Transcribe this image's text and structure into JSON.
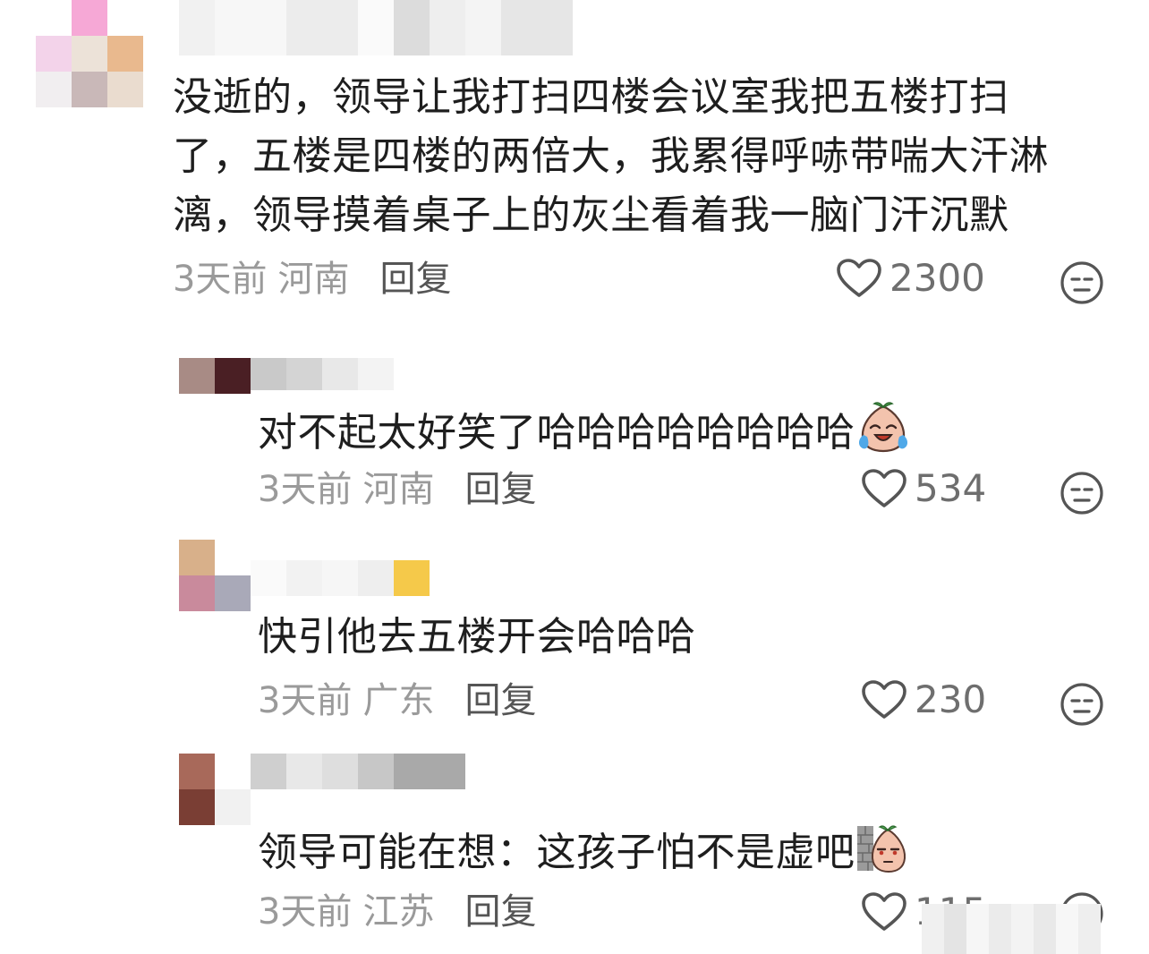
{
  "comments": [
    {
      "text": "没逝的，领导让我打扫四楼会议室我把五楼打扫了，五楼是四楼的两倍大，我累得呼哧带喘大汗淋漓，领导摸着桌子上的灰尘看着我一脑门汗沉默",
      "time": "3天前",
      "location": "河南",
      "reply_label": "回复",
      "likes": "2300"
    },
    {
      "text": "对不起太好笑了哈哈哈哈哈哈哈哈",
      "emoji": "crying-laughing-peach-emoji",
      "time": "3天前",
      "location": "河南",
      "reply_label": "回复",
      "likes": "534"
    },
    {
      "text": "快引他去五楼开会哈哈哈",
      "time": "3天前",
      "location": "广东",
      "reply_label": "回复",
      "likes": "230"
    },
    {
      "text": "领导可能在想：这孩子怕不是虚吧",
      "emoji": "peeking-peach-emoji",
      "time": "3天前",
      "location": "江苏",
      "reply_label": "回复",
      "likes": "115"
    }
  ],
  "colors": {
    "text": "#1e1e1e",
    "meta": "#9a9a9a",
    "icon": "#555555"
  }
}
